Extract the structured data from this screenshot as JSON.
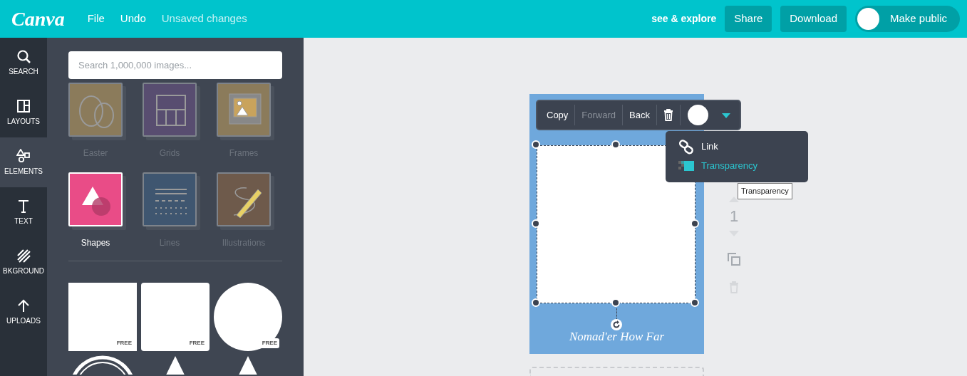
{
  "topbar": {
    "logo": "Canva",
    "menu": [
      "File",
      "Undo"
    ],
    "save_status": "Unsaved changes",
    "explore_link": "see & explore",
    "buttons": [
      "Share",
      "Download"
    ],
    "toggle": {
      "label": "Make public",
      "on": false
    }
  },
  "rail": [
    {
      "label": "SEARCH",
      "selected": false
    },
    {
      "label": "LAYOUTS",
      "selected": false
    },
    {
      "label": "ELEMENTS",
      "selected": true
    },
    {
      "label": "TEXT",
      "selected": false
    },
    {
      "label": "BKGROUND",
      "selected": false
    },
    {
      "label": "UPLOADS",
      "selected": false
    }
  ],
  "panel": {
    "search": {
      "placeholder": "Search 1,000,000 images..."
    },
    "categories": [
      {
        "label": "Easter",
        "color": "#8b7b5b",
        "selected": false
      },
      {
        "label": "Grids",
        "color": "#584d70",
        "selected": false
      },
      {
        "label": "Frames",
        "color": "#8b7b5b",
        "selected": false
      },
      {
        "label": "Shapes",
        "color": "#e94c87",
        "selected": true
      },
      {
        "label": "Lines",
        "color": "#3f5670",
        "selected": false
      },
      {
        "label": "Illustrations",
        "color": "#6e5a4b",
        "selected": false
      }
    ],
    "shapes": [
      {
        "kind": "square",
        "badge": "FREE"
      },
      {
        "kind": "rounded",
        "badge": "FREE"
      },
      {
        "kind": "circle",
        "badge": "FREE"
      },
      {
        "kind": "ring"
      },
      {
        "kind": "triangle"
      },
      {
        "kind": "triangle"
      }
    ]
  },
  "toolbar": {
    "buttons": [
      {
        "label": "Copy",
        "disabled": false
      },
      {
        "label": "Forward",
        "disabled": true
      },
      {
        "label": "Back",
        "disabled": false
      }
    ],
    "dropdown_expanded": true
  },
  "dropdown_menu": [
    {
      "label": "Link",
      "kind": "link",
      "highlighted": false
    },
    {
      "label": "Transparency",
      "kind": "transparency",
      "highlighted": true
    }
  ],
  "tooltip": "Transparency",
  "page": {
    "caption": "Nomad'er How Far",
    "number": "1"
  }
}
